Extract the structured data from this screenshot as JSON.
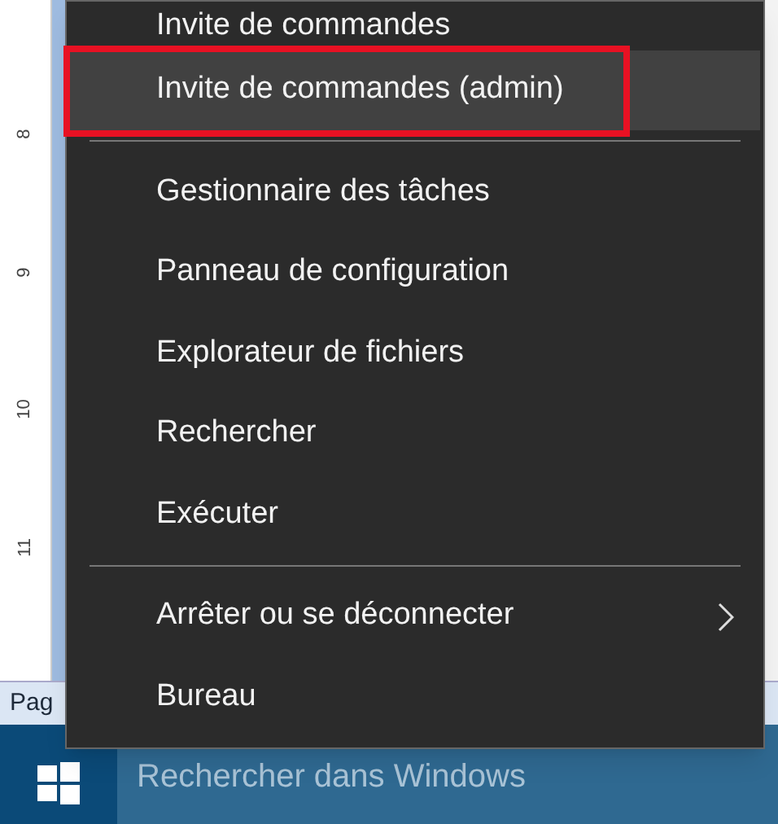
{
  "ruler": {
    "labels": [
      "8",
      "9",
      "10",
      "11"
    ]
  },
  "status_bar": {
    "text": "Pag"
  },
  "taskbar": {
    "search_placeholder": "Rechercher dans Windows"
  },
  "menu": {
    "groups": [
      [
        {
          "label": "Invite de commandes",
          "selected": false,
          "has_submenu": false
        },
        {
          "label": "Invite de commandes (admin)",
          "selected": true,
          "has_submenu": false,
          "highlighted": true
        }
      ],
      [
        {
          "label": "Gestionnaire des tâches",
          "selected": false,
          "has_submenu": false
        },
        {
          "label": "Panneau de configuration",
          "selected": false,
          "has_submenu": false
        },
        {
          "label": "Explorateur de fichiers",
          "selected": false,
          "has_submenu": false
        },
        {
          "label": "Rechercher",
          "selected": false,
          "has_submenu": false
        },
        {
          "label": "Exécuter",
          "selected": false,
          "has_submenu": false
        }
      ],
      [
        {
          "label": "Arrêter ou se déconnecter",
          "selected": false,
          "has_submenu": true
        },
        {
          "label": "Bureau",
          "selected": false,
          "has_submenu": false
        }
      ]
    ]
  }
}
